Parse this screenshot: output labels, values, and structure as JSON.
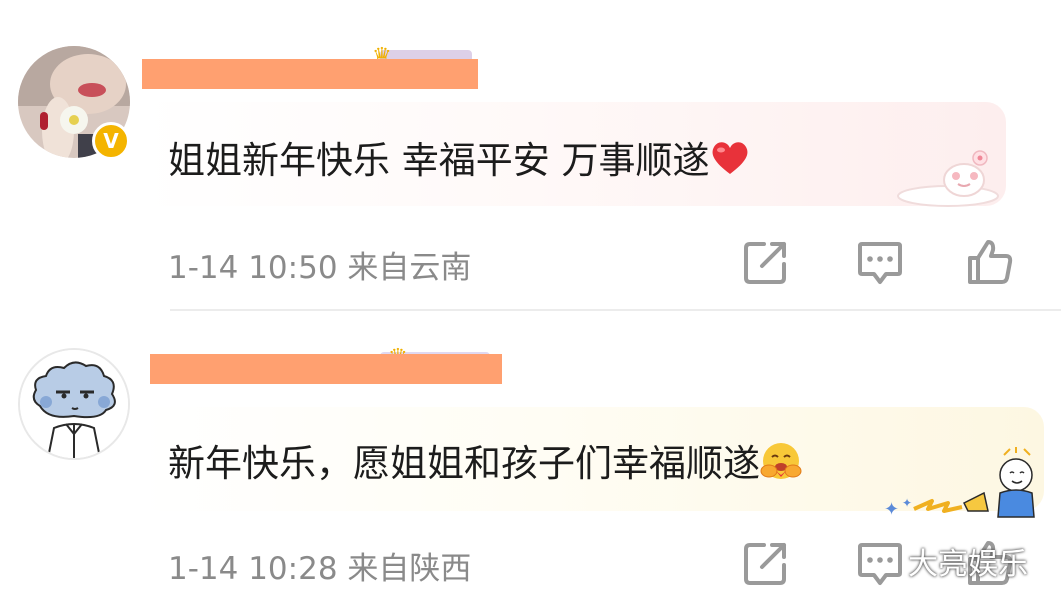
{
  "comments": [
    {
      "text": "姐姐新年快乐 幸福平安 万事顺遂",
      "emoji": "red-heart",
      "time": "1-14 10:50",
      "location": "来自云南",
      "verified_badge": "V",
      "bubble_decoration": "sleeping-cat"
    },
    {
      "text": "新年快乐，愿姐姐和孩子们幸福顺遂",
      "emoji": "hugging-face",
      "time": "1-14 10:28",
      "location": "来自陕西",
      "bubble_decoration": "cartoon-megaphone-boy"
    }
  ],
  "actions": [
    "share-icon",
    "reply-icon",
    "like-icon"
  ],
  "watermark": "大亮娱乐",
  "colors": {
    "redaction": "#ffa070",
    "meta_text": "#8a8a8a",
    "body_text": "#1c1c1c",
    "badge": "#f4b400",
    "heart": "#e8323a"
  }
}
